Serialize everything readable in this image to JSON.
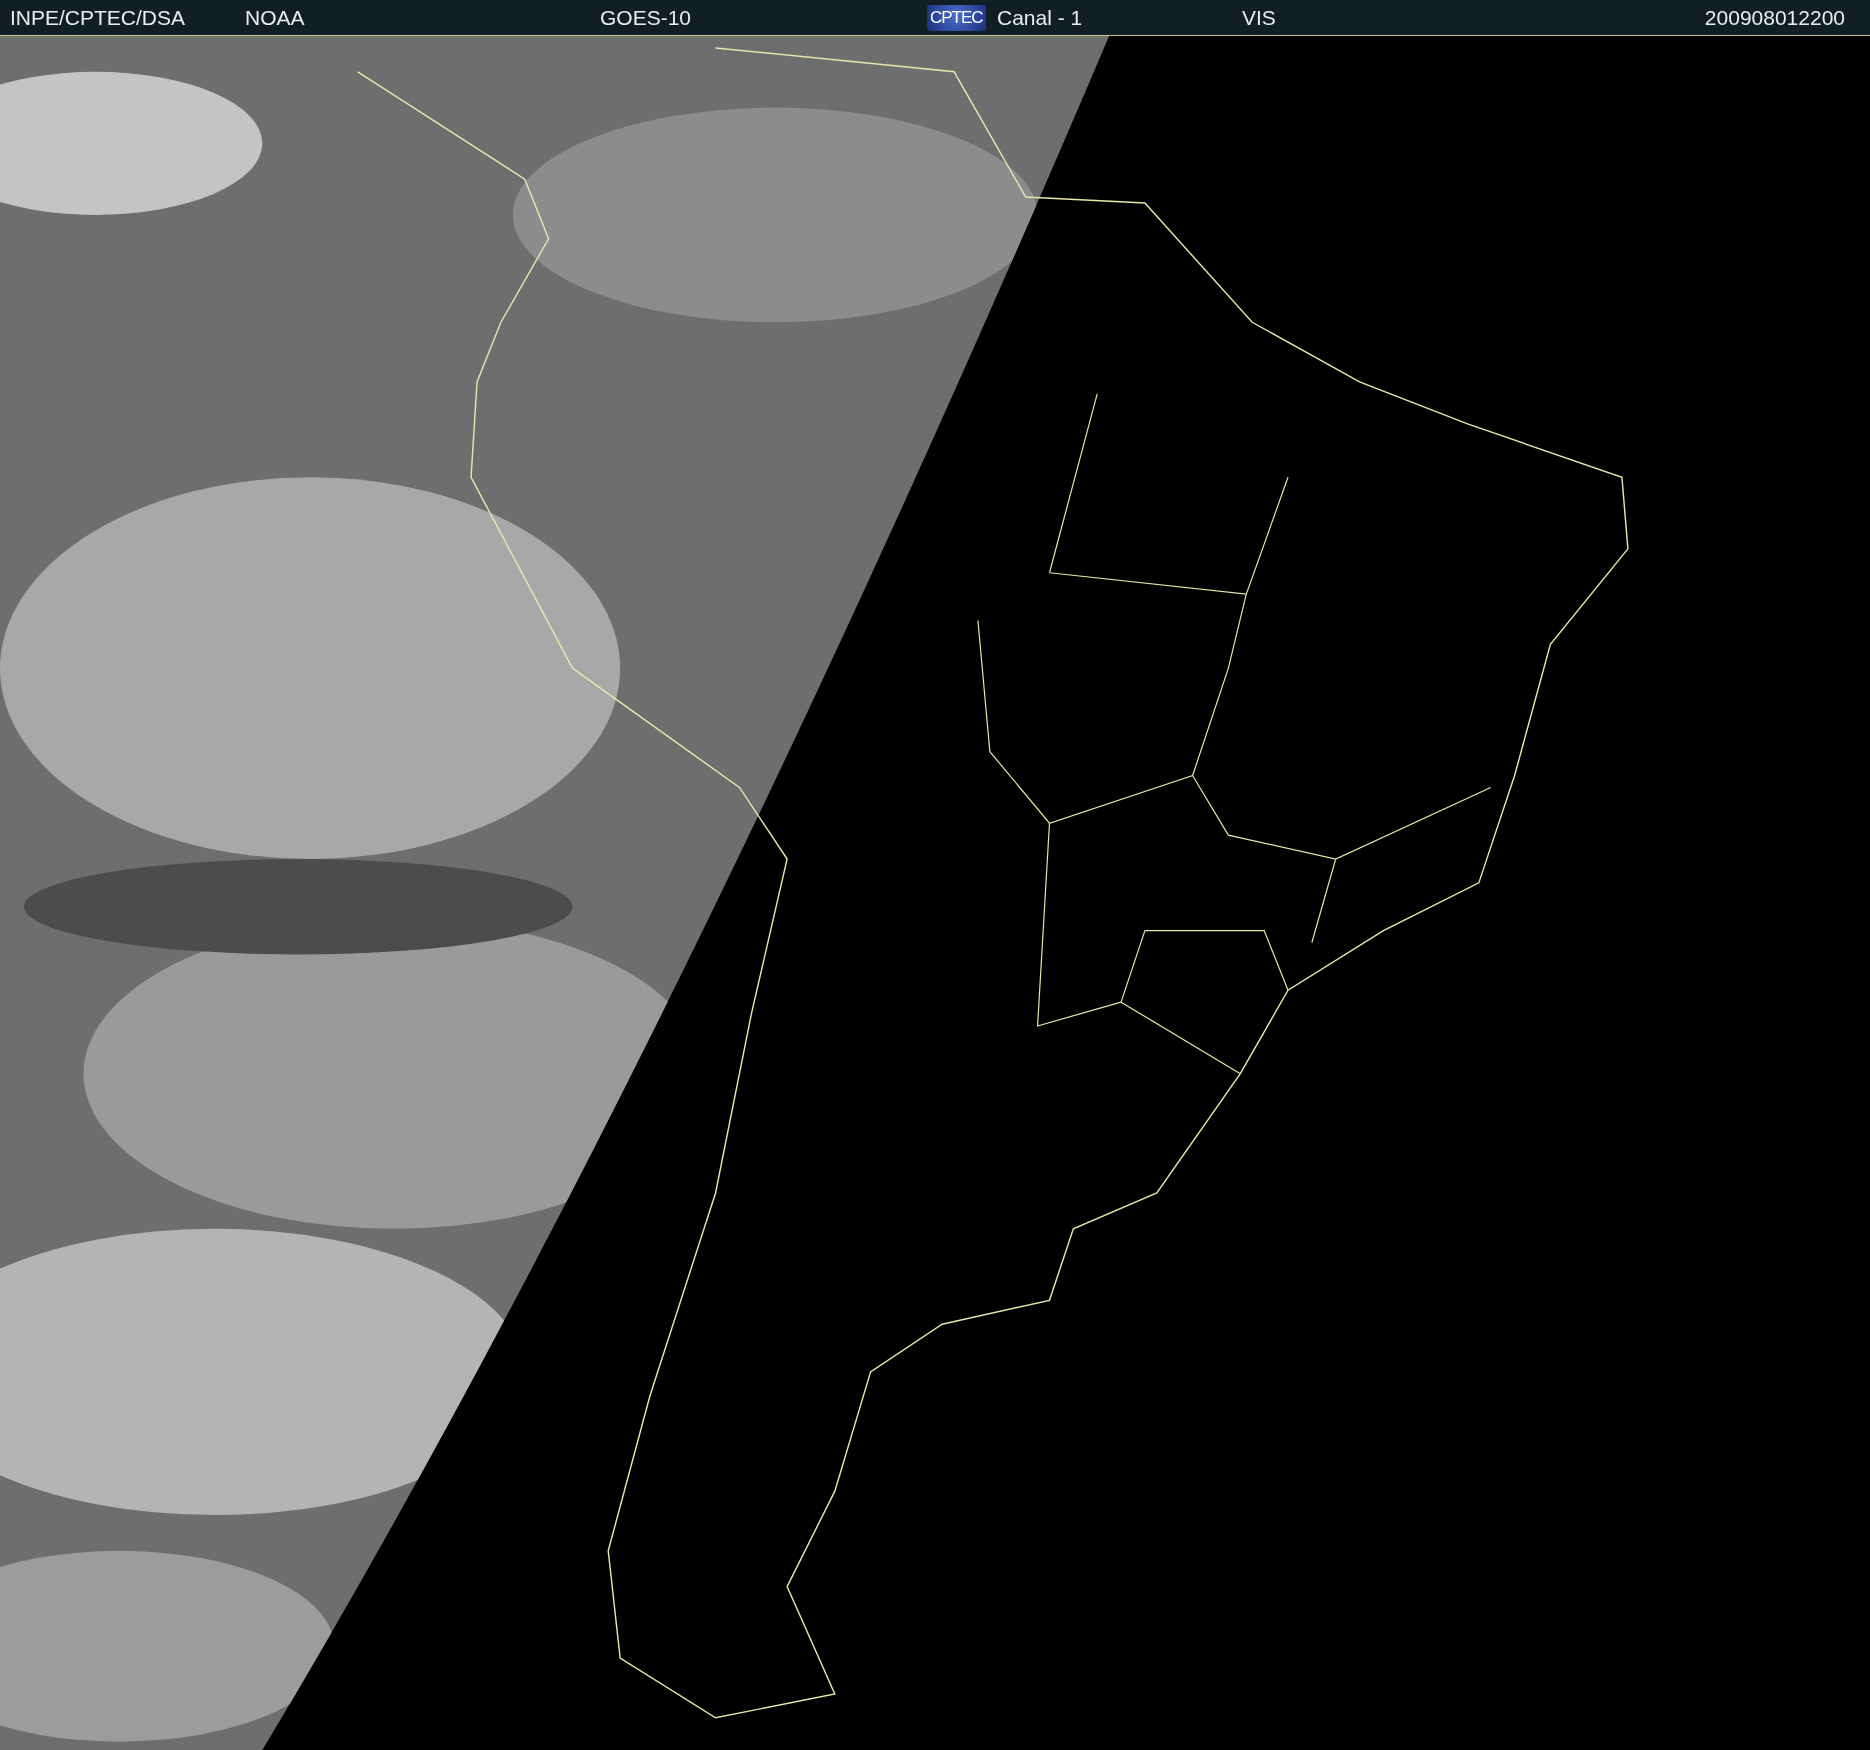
{
  "header": {
    "items": [
      {
        "kind": "text",
        "text": "INPE/CPTEC/DSA"
      },
      {
        "kind": "text",
        "text": "NOAA"
      },
      {
        "kind": "text",
        "text": "GOES-10"
      },
      {
        "kind": "logo",
        "text": "CPTEC"
      },
      {
        "kind": "text",
        "text": "Canal - 1"
      },
      {
        "kind": "text",
        "text": "VIS"
      },
      {
        "kind": "text",
        "text": "200908012200"
      }
    ]
  }
}
